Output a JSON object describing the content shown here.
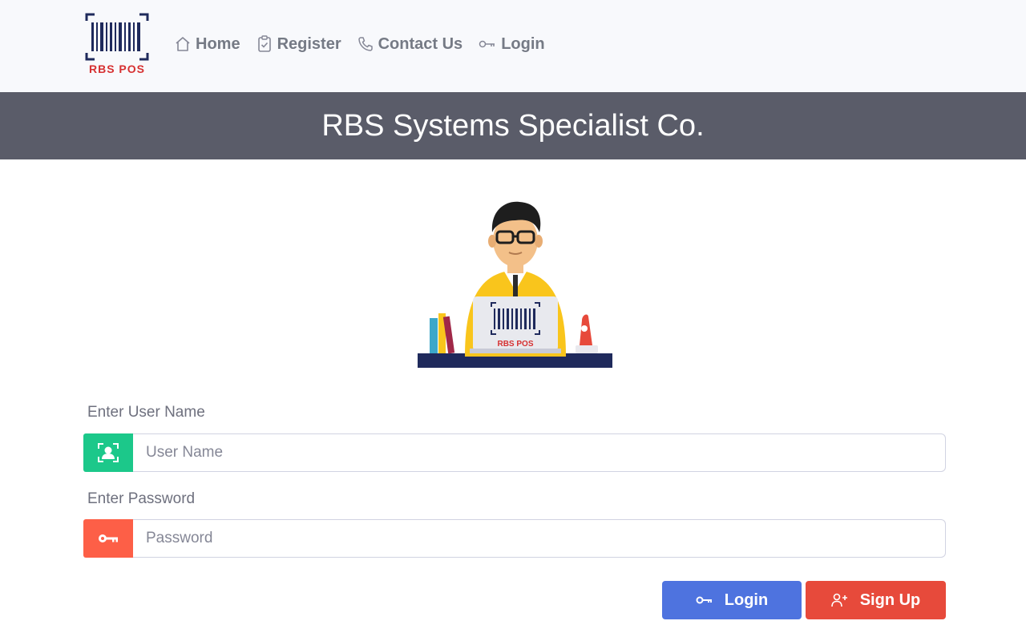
{
  "brand": {
    "logo_text": "RBS POS"
  },
  "nav": {
    "items": [
      {
        "label": "Home",
        "icon": "home-icon"
      },
      {
        "label": "Register",
        "icon": "clipboard-icon"
      },
      {
        "label": "Contact Us",
        "icon": "phone-icon"
      },
      {
        "label": "Login",
        "icon": "key-icon"
      }
    ]
  },
  "banner": {
    "title": "RBS Systems Specialist Co."
  },
  "illustration": {
    "screen_text": "RBS POS"
  },
  "form": {
    "username_label": "Enter User Name",
    "username_placeholder": "User Name",
    "username_value": "",
    "password_label": "Enter Password",
    "password_placeholder": "Password",
    "password_value": ""
  },
  "buttons": {
    "login_label": "Login",
    "signup_label": "Sign Up"
  },
  "colors": {
    "navbar_bg": "#f8f9fc",
    "banner_bg": "#5a5c69",
    "user_addon": "#1cc88a",
    "pass_addon": "#fd5f47",
    "login_btn": "#4e73df",
    "signup_btn": "#e74a3b",
    "brand_red": "#d63031",
    "brand_navy": "#1f2a5c"
  }
}
